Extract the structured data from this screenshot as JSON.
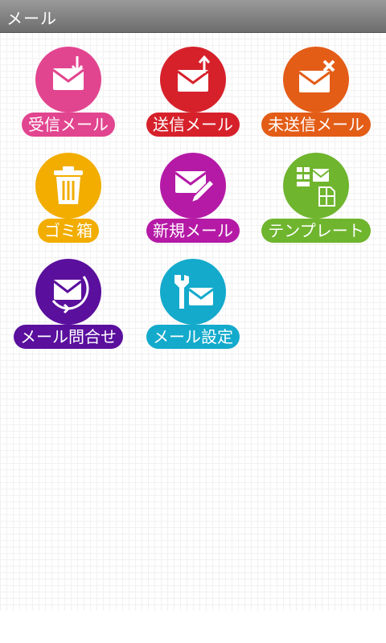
{
  "window": {
    "title": "メール"
  },
  "menu": [
    {
      "label": "受信メール",
      "color": "#e2458f",
      "icon": "inbox-mail-icon"
    },
    {
      "label": "送信メール",
      "color": "#d6212b",
      "icon": "sent-mail-icon"
    },
    {
      "label": "未送信メール",
      "color": "#e35d17",
      "icon": "unsent-mail-icon"
    },
    {
      "label": "ゴミ箱",
      "color": "#f2ad00",
      "icon": "trash-icon"
    },
    {
      "label": "新規メール",
      "color": "#b51aa6",
      "icon": "new-mail-icon"
    },
    {
      "label": "テンプレート",
      "color": "#6fb52e",
      "icon": "template-icon"
    },
    {
      "label": "メール問合せ",
      "color": "#5a0f9d",
      "icon": "mail-query-icon"
    },
    {
      "label": "メール設定",
      "color": "#13aacc",
      "icon": "mail-settings-icon"
    }
  ]
}
